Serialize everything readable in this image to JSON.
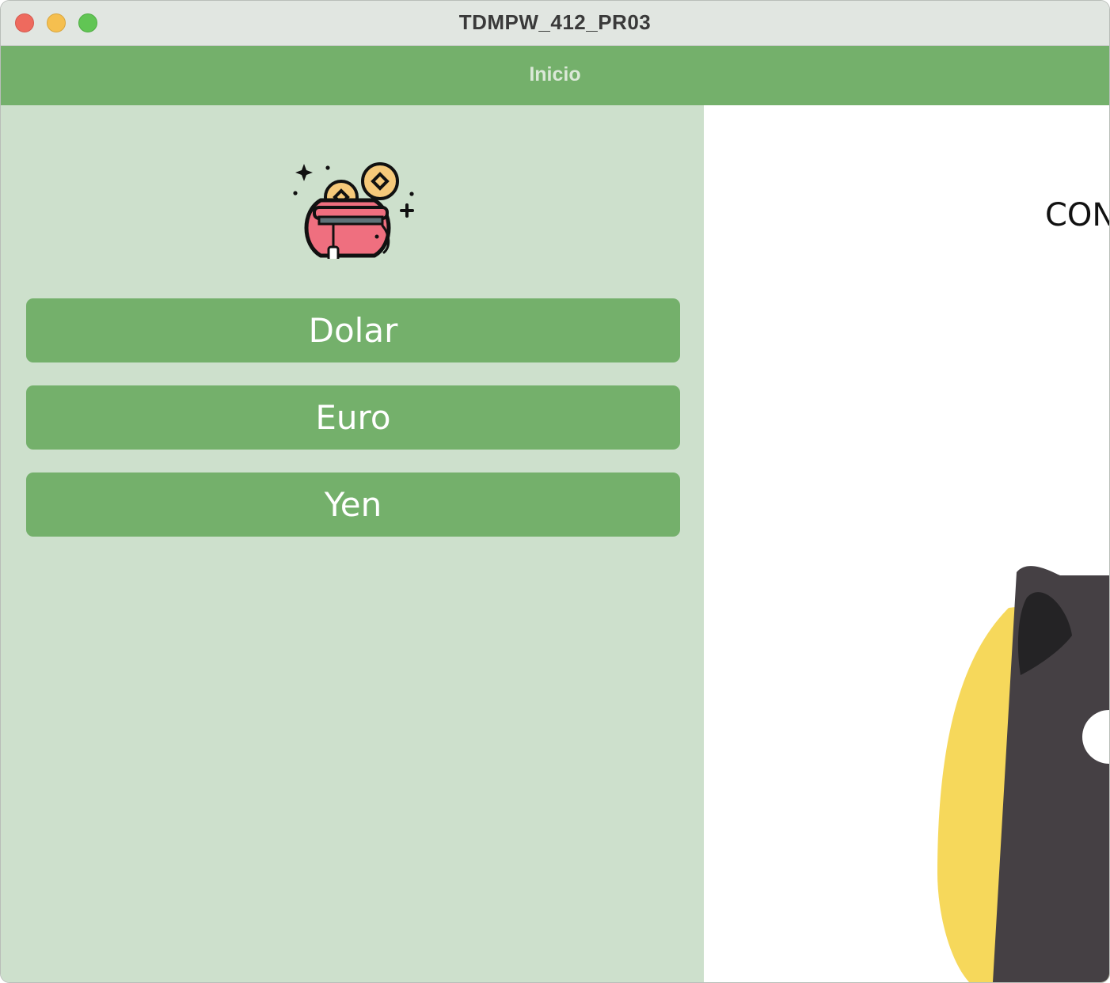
{
  "window": {
    "title": "TDMPW_412_PR03",
    "controls": {
      "close": "close-icon",
      "minimize": "minimize-icon",
      "zoom": "zoom-icon"
    }
  },
  "appbar": {
    "title": "Inicio",
    "color": "#74b06b"
  },
  "sidebar": {
    "logo_icon": "money-bag-icon",
    "background": "#cde0cc",
    "buttons": [
      {
        "label": "Dolar"
      },
      {
        "label": "Euro"
      },
      {
        "label": "Yen"
      }
    ]
  },
  "main": {
    "heading": "CON",
    "illustration_icon": "penguin-mascot-icon"
  },
  "colors": {
    "accent": "#74b06b",
    "sidebar_bg": "#cde0cc",
    "mascot_yellow": "#f6d85b",
    "mascot_dark": "#454044"
  }
}
